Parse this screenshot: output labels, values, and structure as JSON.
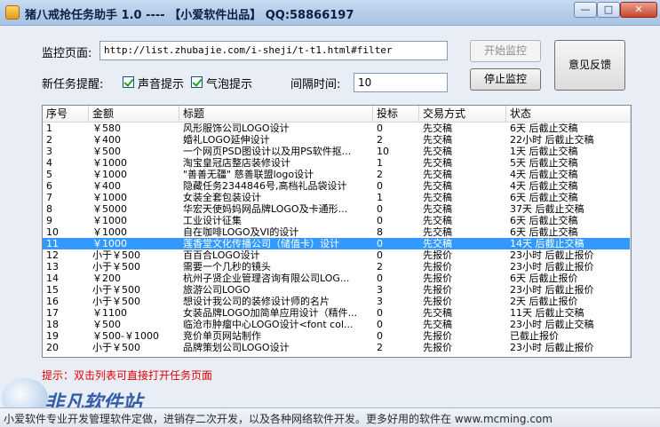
{
  "window": {
    "title": "猪八戒抢任务助手 1.0 ---- 【小爱软件出品】 QQ:58866197",
    "min": "—",
    "max": "□",
    "close": "✕"
  },
  "form": {
    "url_label": "监控页面:",
    "url_value": "http://list.zhubajie.com/i-sheji/t-t1.html#filter",
    "notify_label": "新任务提醒:",
    "sound_label": "声音提示",
    "bubble_label": "气泡提示",
    "interval_label": "间隔时间:",
    "interval_value": "10",
    "start_button": "开始监控",
    "stop_button": "停止监控",
    "feedback_button": "意见反馈"
  },
  "table": {
    "columns": [
      "序号",
      "金额",
      "标题",
      "投标",
      "交易方式",
      "状态"
    ],
    "selected_index": 10,
    "rows": [
      [
        "1",
        "￥580",
        "风形服饰公司LOGO设计",
        "0",
        "先交稿",
        "6天 后截止交稿"
      ],
      [
        "2",
        "￥400",
        "婚礼LOGO延伸设计",
        "2",
        "先交稿",
        "22小时 后截止交稿"
      ],
      [
        "3",
        "￥500",
        "一个网页PSD图设计以及用PS软件抠...",
        "10",
        "先交稿",
        "1天 后截止交稿"
      ],
      [
        "4",
        "￥1000",
        "淘宝皇冠店整店装修设计",
        "1",
        "先交稿",
        "5天 后截止交稿"
      ],
      [
        "5",
        "￥1000",
        "\"善善无疆\" 慈善联盟logo设计",
        "2",
        "先交稿",
        "4天 后截止交稿"
      ],
      [
        "6",
        "￥400",
        "隐藏任务2344846号,高档礼品袋设计",
        "0",
        "先交稿",
        "4天 后截止交稿"
      ],
      [
        "7",
        "￥1000",
        "女装全套包装设计",
        "1",
        "先交稿",
        "6天 后截止交稿"
      ],
      [
        "8",
        "￥5000",
        "华宏天使妈妈网品牌LOGO及卡通形...",
        "0",
        "先交稿",
        "37天 后截止交稿"
      ],
      [
        "9",
        "￥1000",
        "工业设计征集",
        "0",
        "先交稿",
        "6天 后截止交稿"
      ],
      [
        "10",
        "￥1000",
        "自在咖啡LOGO及VI的设计",
        "8",
        "先交稿",
        "6天 后截止交稿"
      ],
      [
        "11",
        "￥1000",
        "莲香堂文化传播公司（储值卡）设计",
        "0",
        "先交稿",
        "14天 后截止交稿"
      ],
      [
        "12",
        "小于￥500",
        "百百合LOGO设计",
        "0",
        "先报价",
        "23小时 后截止报价"
      ],
      [
        "13",
        "小于￥500",
        "需要一个几秒的镜头",
        "2",
        "先报价",
        "23小时 后截止报价"
      ],
      [
        "14",
        "￥200",
        "杭州子贤企业管理咨询有限公司LOG...",
        "0",
        "先报价",
        "6天 后截止报价"
      ],
      [
        "15",
        "小于￥500",
        "旅游公司LOGO",
        "3",
        "先报价",
        "23小时 后截止报价"
      ],
      [
        "16",
        "小于￥500",
        "想设计我公司的装修设计师的名片",
        "3",
        "先报价",
        "2天 后截止报价"
      ],
      [
        "17",
        "￥1100",
        "女装品牌LOGO加简单应用设计（精件...",
        "0",
        "先交稿",
        "11天 后截止交稿"
      ],
      [
        "18",
        "￥500",
        "临沧市肿瘤中心LOGO设计<font col...",
        "0",
        "先交稿",
        "23小时 后截止交稿"
      ],
      [
        "19",
        "￥500-￥1000",
        "竞价单页网站制作",
        "0",
        "先报价",
        "已截止报价"
      ],
      [
        "20",
        "小于￥500",
        "品牌策划公司LOGO设计",
        "2",
        "先报价",
        "23小时 后截止报价"
      ]
    ]
  },
  "hint": "提示：双击列表可直接打开任务页面",
  "watermark": "非凡软件站",
  "status": "小爱软件专业开发管理软件定做，进销存二次开发，以及各种网络软件开发。更多好用的软件在 www.mcming.com",
  "colors": {
    "selected_row": "#3399ff",
    "hint": "#e00000",
    "titlebar": "#b6cde9"
  }
}
